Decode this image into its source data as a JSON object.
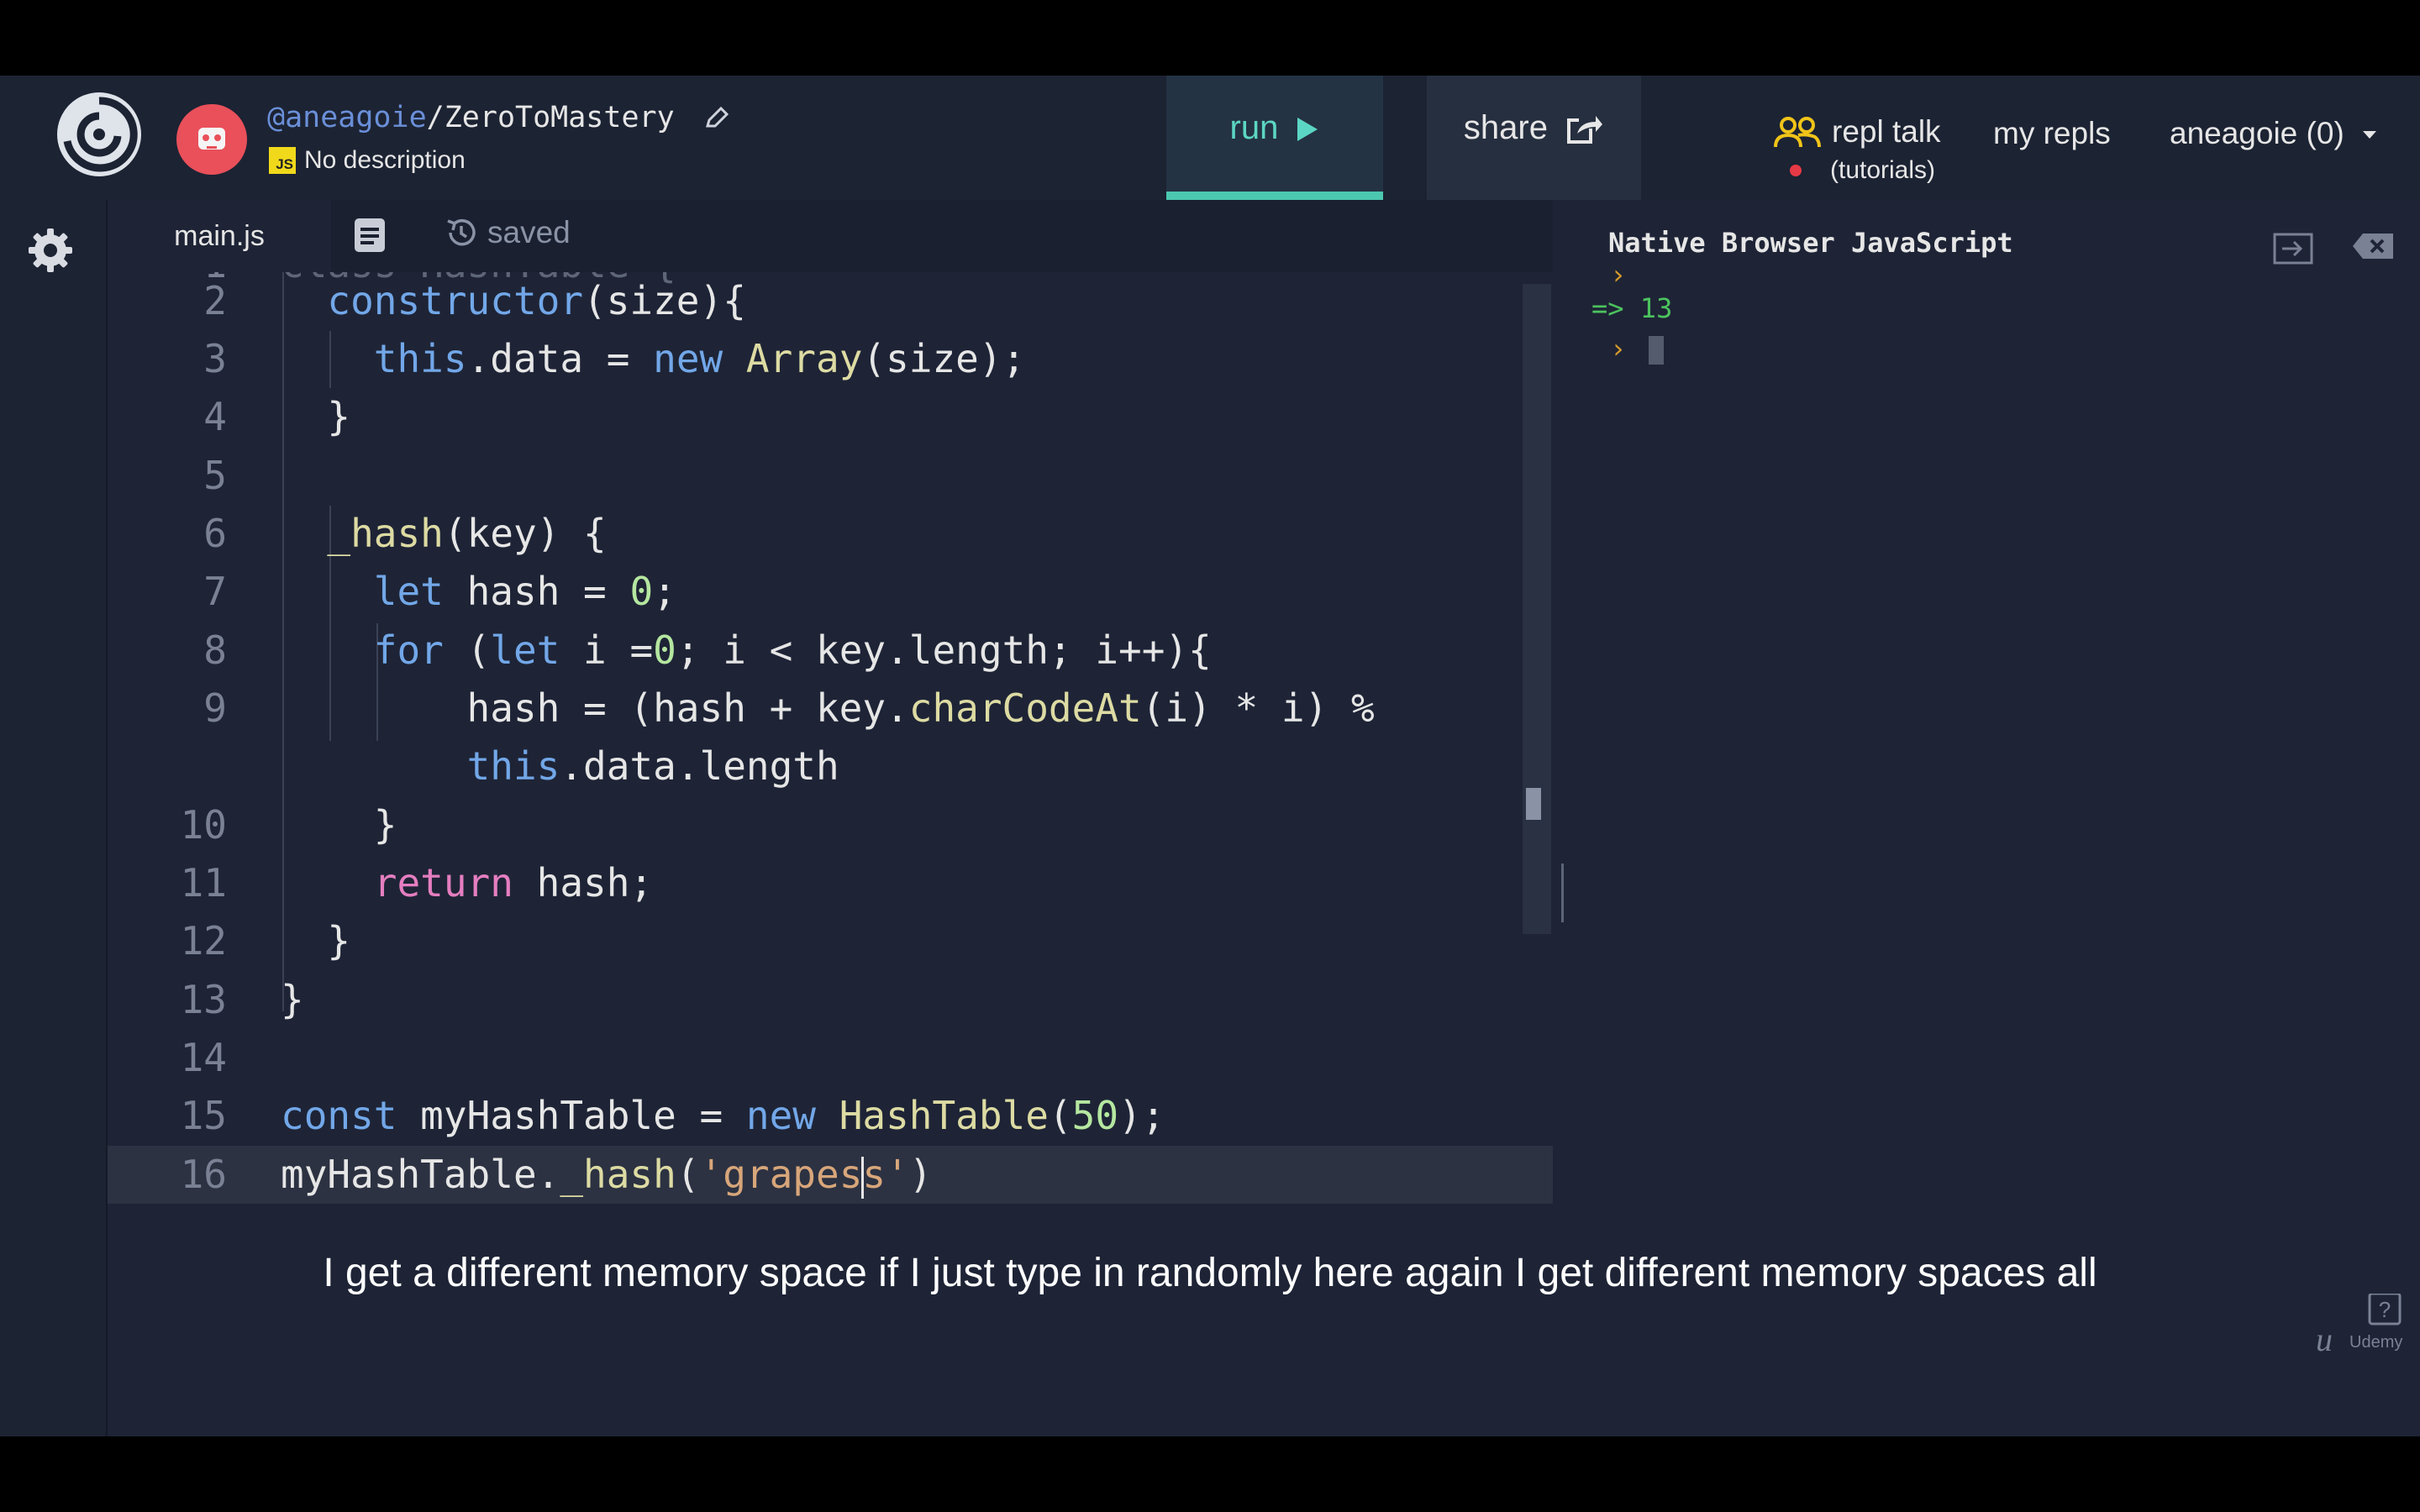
{
  "header": {
    "username": "@aneagoie",
    "separator": "/",
    "repl_name": "ZeroToMastery",
    "description": "No description",
    "language_badge": "JS",
    "run_label": "run",
    "share_label": "share",
    "nav": {
      "repl_talk": "repl talk",
      "tutorials": "(tutorials)",
      "my_repls": "my repls",
      "user_menu": "aneagoie (0)"
    }
  },
  "editor": {
    "tab_label": "main.js",
    "saved_label": "saved",
    "partial_line": "class HashTable {",
    "line_numbers": [
      "2",
      "3",
      "4",
      "5",
      "6",
      "7",
      "8",
      "9",
      "10",
      "11",
      "12",
      "13",
      "14",
      "15",
      "16"
    ]
  },
  "console": {
    "title": "Native Browser JavaScript",
    "prompt_symbol": "›",
    "result": "=> 13"
  },
  "subtitle": "I get a different memory space if I just type in randomly here again I get different memory spaces all",
  "colors": {
    "background": "#1c2333",
    "editor_bg": "#1e2436",
    "accent": "#4cc7b0",
    "keyword": "#72a7e8",
    "function": "#dddba3",
    "string": "#d8a67a",
    "return_kw": "#e57ec0",
    "console_result": "#4cc35e"
  }
}
